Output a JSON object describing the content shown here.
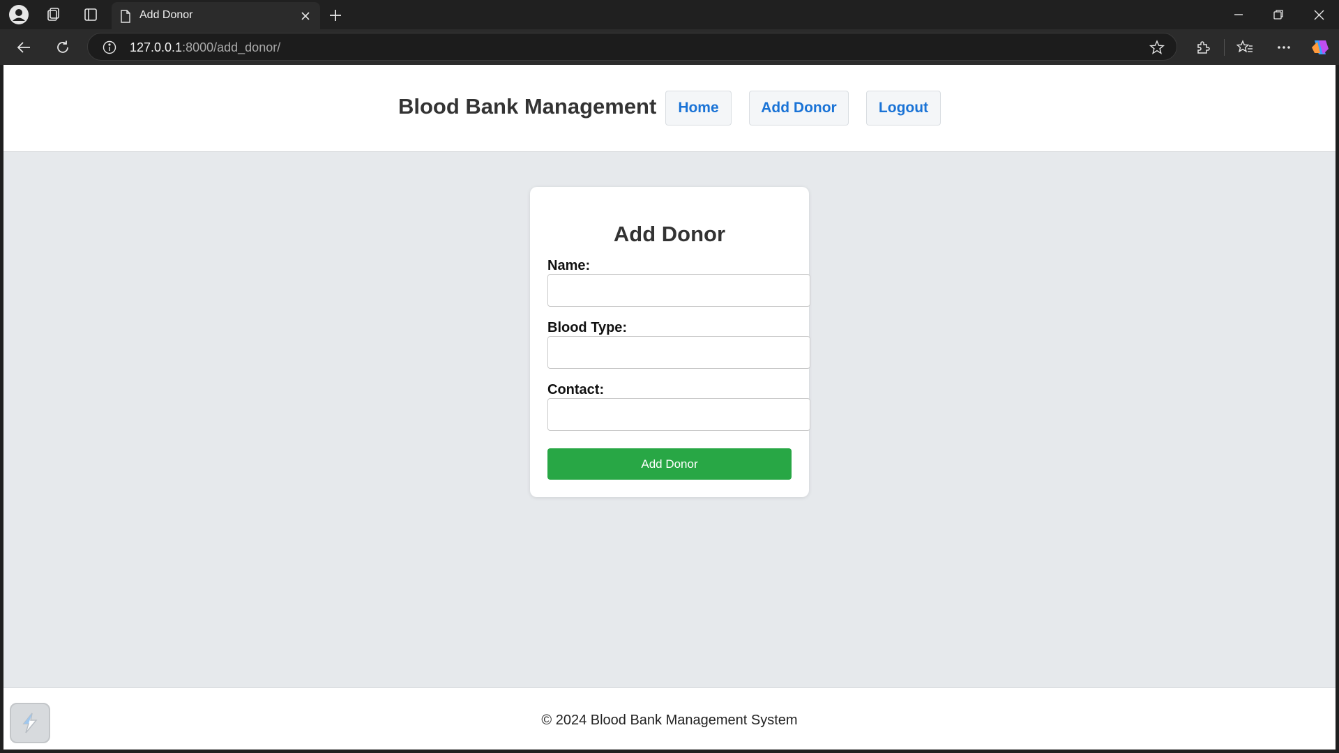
{
  "browser": {
    "tab_title": "Add Donor",
    "url_host": "127.0.0.1",
    "url_rest": ":8000/add_donor/"
  },
  "header": {
    "title": "Blood Bank Management",
    "nav": [
      {
        "label": "Home"
      },
      {
        "label": "Add Donor"
      },
      {
        "label": "Logout"
      }
    ]
  },
  "form": {
    "heading": "Add Donor",
    "fields": [
      {
        "label": "Name:",
        "value": ""
      },
      {
        "label": "Blood Type:",
        "value": ""
      },
      {
        "label": "Contact:",
        "value": ""
      }
    ],
    "submit_label": "Add Donor"
  },
  "footer": {
    "text": "© 2024 Blood Bank Management System"
  },
  "colors": {
    "nav_link": "#1a73d6",
    "submit_button": "#28a745",
    "page_background": "#e6e9ec"
  }
}
